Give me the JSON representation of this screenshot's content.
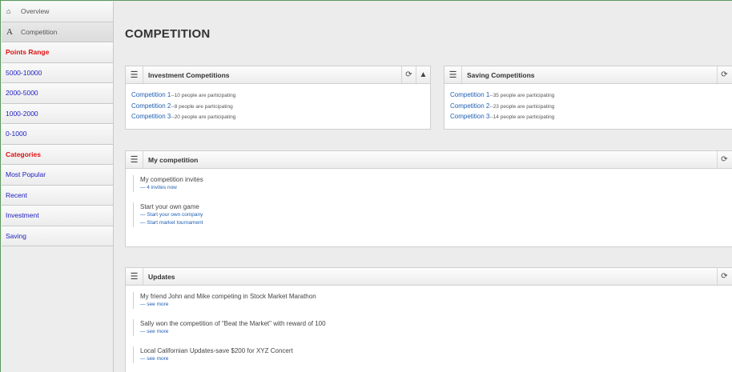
{
  "sidebar": {
    "items": [
      {
        "label": "Overview",
        "kind": "nav",
        "icon": "home-icon"
      },
      {
        "label": "Competition",
        "kind": "nav",
        "icon": "font-a-icon"
      },
      {
        "label": "Points Range",
        "kind": "head"
      },
      {
        "label": "5000-10000",
        "kind": "link"
      },
      {
        "label": "2000-5000",
        "kind": "link"
      },
      {
        "label": "1000-2000",
        "kind": "link"
      },
      {
        "label": "0-1000",
        "kind": "link"
      },
      {
        "label": "Categories",
        "kind": "head"
      },
      {
        "label": "Most Popular",
        "kind": "link"
      },
      {
        "label": "Recent",
        "kind": "link"
      },
      {
        "label": "Investment",
        "kind": "link"
      },
      {
        "label": "Saving",
        "kind": "link"
      }
    ]
  },
  "page": {
    "title": "COMPETITION"
  },
  "investment": {
    "title": "Investment Competitions",
    "items": [
      {
        "link": "Competition 1",
        "detail": "--10 people are participating"
      },
      {
        "link": "Competition 2",
        "detail": "--8 people are participating"
      },
      {
        "link": "Competition 3",
        "detail": "--20 people are participating"
      }
    ]
  },
  "saving": {
    "title": "Saving Competitions",
    "items": [
      {
        "link": "Competition 1",
        "detail": "--35 people are participating"
      },
      {
        "link": "Competition 2",
        "detail": "--23 people are participating"
      },
      {
        "link": "Competition 3",
        "detail": "--14 people are participating"
      }
    ]
  },
  "my_competition": {
    "title": "My competition",
    "groups": [
      {
        "title": "My competition invites",
        "links": [
          "— 4 invites now"
        ]
      },
      {
        "title": "Start your own game",
        "links": [
          "— Start your own company",
          "— Start market tournament"
        ]
      }
    ]
  },
  "updates": {
    "title": "Updates",
    "items": [
      {
        "title": "My friend John and Mike competing in Stock Market Marathon",
        "link": "— see more"
      },
      {
        "title": "Sally won the competition of \"Beat the Market\" with reward of 100",
        "link": "— see more"
      },
      {
        "title": "Local Californian Updates-save $200 for XYZ Concert",
        "link": "— see more"
      }
    ]
  },
  "icons": {
    "menu": "☰",
    "refresh": "⟳",
    "trash": "🗑",
    "home": "🏠",
    "font": "A"
  }
}
